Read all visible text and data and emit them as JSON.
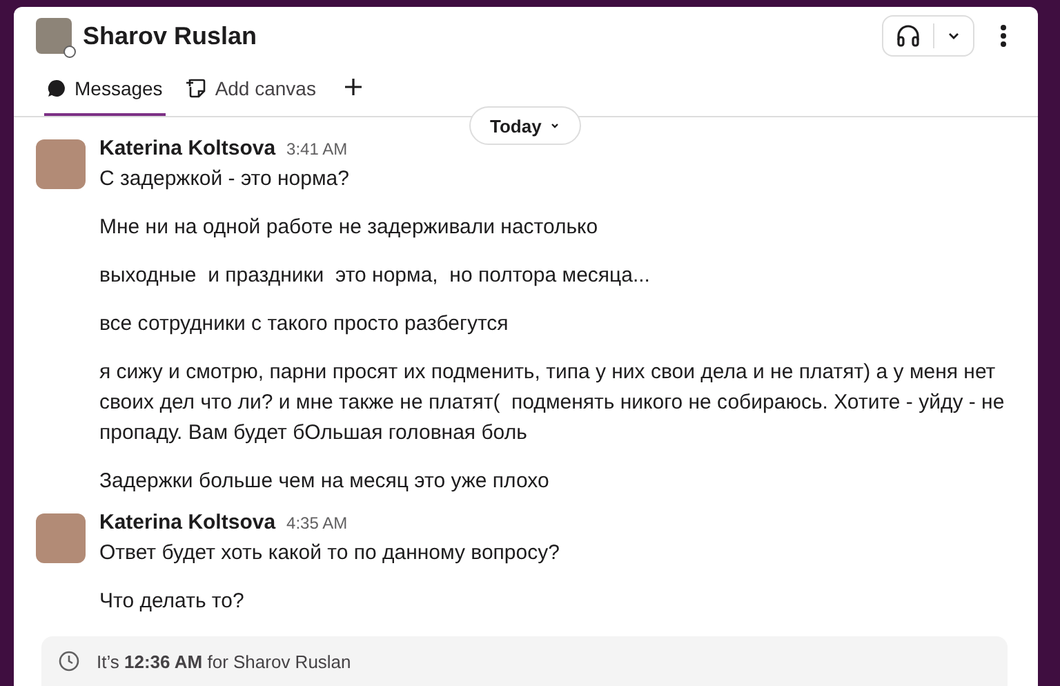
{
  "header": {
    "title": "Sharov Ruslan"
  },
  "tabs": [
    {
      "label": "Messages",
      "selected": true
    },
    {
      "label": "Add canvas",
      "selected": false
    }
  ],
  "date_divider": {
    "label": "Today"
  },
  "messages": [
    {
      "author": "Katerina Koltsova",
      "time": "3:41 AM",
      "lines": [
        "С задержкой - это норма?",
        "Мне ни на одной работе не задерживали настолько",
        "выходные  и праздники  это норма,  но полтора месяца...",
        "все сотрудники с такого просто разбегутся",
        "я сижу и смотрю, парни просят их подменить, типа у них свои дела и не платят) а у меня нет своих дел что ли? и мне также не платят(  подменять никого не собираюсь. Хотите - уйду - не пропаду. Вам будет бОльшая головная боль",
        "Задержки больше чем на месяц это уже плохо"
      ]
    },
    {
      "author": "Katerina Koltsova",
      "time": "4:35 AM",
      "lines": [
        "Ответ будет хоть какой то по данному вопросу?",
        "Что делать то?"
      ]
    }
  ],
  "local_time_notice": "It’s **12:36 AM** for Sharov Ruslan"
}
